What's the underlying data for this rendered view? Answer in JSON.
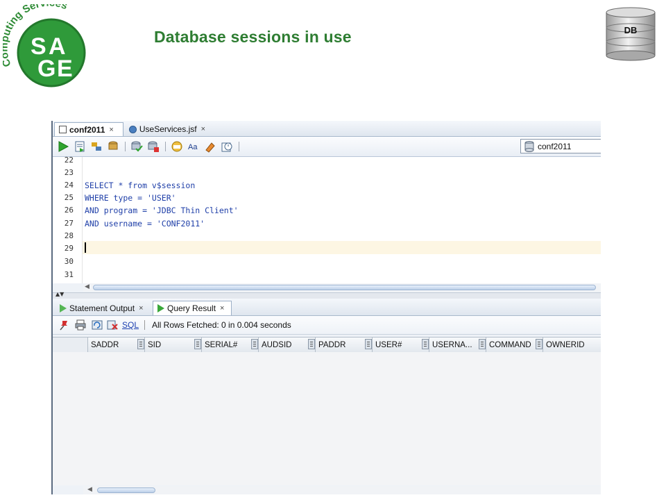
{
  "slide": {
    "title": "Database sessions in use",
    "logo": {
      "arc_text": "Computing Services",
      "letters": [
        "S",
        "A",
        "G",
        "E"
      ]
    },
    "db_badge": "DB"
  },
  "ide": {
    "tabs": [
      {
        "label": "conf2011",
        "close": "×"
      },
      {
        "label": "UseServices.jsf",
        "close": "×"
      }
    ],
    "connection": "conf2011",
    "editor": {
      "line_numbers": [
        "22",
        "23",
        "24",
        "25",
        "26",
        "27",
        "28",
        "29",
        "30",
        "31"
      ],
      "code": [
        "",
        "",
        "SELECT * from v$session",
        "WHERE type = 'USER'",
        "AND program = 'JDBC Thin Client'",
        "AND username = 'CONF2011'",
        "",
        "",
        "",
        ""
      ]
    },
    "bottom_tabs": [
      {
        "label": "Statement Output",
        "close": "×"
      },
      {
        "label": "Query Result",
        "close": "×"
      }
    ],
    "result": {
      "sql_link": "SQL",
      "status": "All Rows Fetched: 0 in 0.004 seconds",
      "columns": [
        "SADDR",
        "SID",
        "SERIAL#",
        "AUDSID",
        "PADDR",
        "USER#",
        "USERNA...",
        "COMMAND",
        "OWNERID"
      ]
    }
  },
  "colors": {
    "title_green": "#2e7d32",
    "logo_green": "#2f9a3a",
    "code_blue": "#1f3fa8"
  }
}
